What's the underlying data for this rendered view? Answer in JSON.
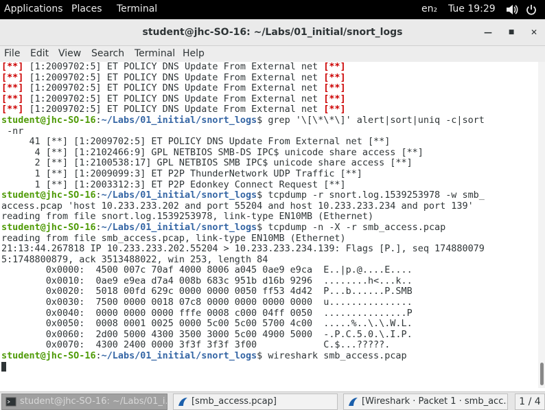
{
  "topbar": {
    "applications": "Applications",
    "places": "Places",
    "app_name": "Terminal",
    "keyboard": "en₂",
    "clock": "Tue 19:29"
  },
  "window": {
    "title": "student@jhc-SO-16: ~/Labs/01_initial/snort_logs"
  },
  "menu": {
    "file": "File",
    "edit": "Edit",
    "view": "View",
    "search": "Search",
    "terminal": "Terminal",
    "help": "Help"
  },
  "terminal": {
    "alert_lines": [
      {
        "pre": "[**]",
        "text": " [1:2009702:5] ET POLICY DNS Update From External net ",
        "post": "[**]"
      },
      {
        "pre": "[**]",
        "text": " [1:2009702:5] ET POLICY DNS Update From External net ",
        "post": "[**]"
      },
      {
        "pre": "[**]",
        "text": " [1:2009702:5] ET POLICY DNS Update From External net ",
        "post": "[**]"
      },
      {
        "pre": "[**]",
        "text": " [1:2009702:5] ET POLICY DNS Update From External net ",
        "post": "[**]"
      },
      {
        "pre": "[**]",
        "text": " [1:2009702:5] ET POLICY DNS Update From External net ",
        "post": "[**]"
      }
    ],
    "prompt_user": "student@jhc-SO-16",
    "prompt_sep": ":",
    "prompt_path": "~/Labs/01_initial/snort_logs",
    "prompt_dollar": "$",
    "cmd1": " grep '\\[\\*\\*\\]' alert|sort|uniq -c|sort",
    "cmd1_cont": " -nr",
    "counts": [
      "     41 [**] [1:2009702:5] ET POLICY DNS Update From External net [**]",
      "      4 [**] [1:2102466:9] GPL NETBIOS SMB-DS IPC$ unicode share access [**]",
      "      2 [**] [1:2100538:17] GPL NETBIOS SMB IPC$ unicode share access [**]",
      "      1 [**] [1:2009099:3] ET P2P ThunderNetwork UDP Traffic [**]",
      "      1 [**] [1:2003312:3] ET P2P Edonkey Connect Request [**]"
    ],
    "cmd2": " tcpdump -r snort.log.1539253978 -w smb_",
    "cmd2_cont": "access.pcap 'host 10.233.233.202 and port 55204 and host 10.233.233.234 and port 139'",
    "out2": "reading from file snort.log.1539253978, link-type EN10MB (Ethernet)",
    "cmd3": " tcpdump -n -X -r smb_access.pcap",
    "out3": [
      "reading from file smb_access.pcap, link-type EN10MB (Ethernet)",
      "21:13:44.267818 IP 10.233.233.202.55204 > 10.233.233.234.139: Flags [P.], seq 174880079",
      "5:1748800879, ack 3513488022, win 253, length 84",
      "        0x0000:  4500 007c 70af 4000 8006 a045 0ae9 e9ca  E..|p.@....E....",
      "        0x0010:  0ae9 e9ea d7a4 008b 683c 951b d16b 9296  ........h<...k..",
      "        0x0020:  5018 00fd 629c 0000 0000 0050 ff53 4d42  P...b......P.SMB",
      "        0x0030:  7500 0000 0018 07c8 0000 0000 0000 0000  u...............",
      "        0x0040:  0000 0000 0000 fffe 0008 c000 04ff 0050  ...............P",
      "        0x0050:  0008 0001 0025 0000 5c00 5c00 5700 4c00  .....%..\\.\\.W.L.",
      "        0x0060:  2d00 5000 4300 3500 3000 5c00 4900 5000  -.P.C.5.0.\\.I.P.",
      "        0x0070:  4300 2400 0000 3f3f 3f3f 3f00            C.$...?????."
    ],
    "cmd4": " wireshark smb_access.pcap"
  },
  "taskbar": {
    "task1": "student@jhc-SO-16: ~/Labs/01_i...",
    "task2": "[smb_access.pcap]",
    "task3": "[Wireshark · Packet 1 · smb_acc...",
    "pager": "1 / 4"
  }
}
